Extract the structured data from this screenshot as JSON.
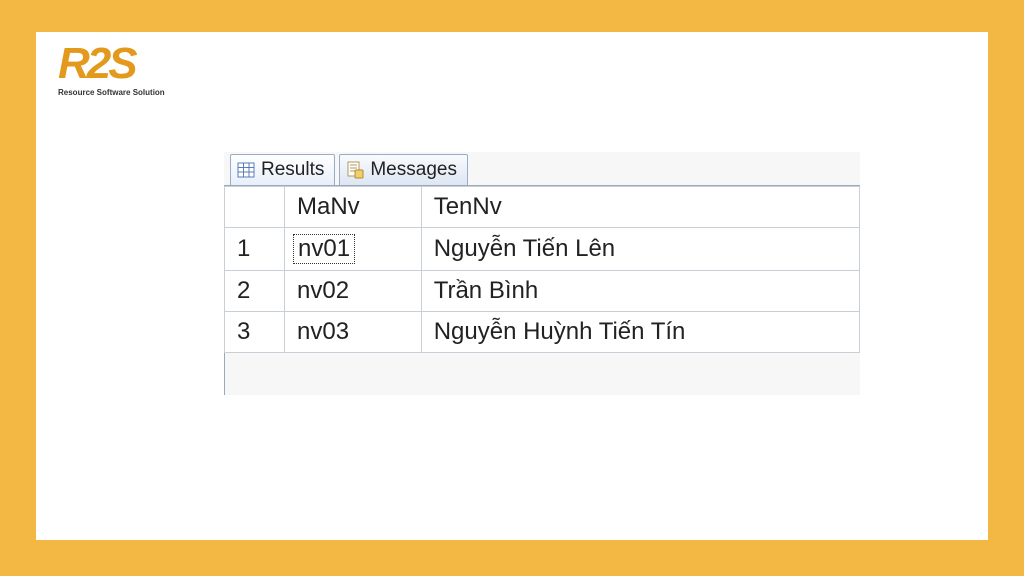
{
  "logo": {
    "text": "R2S",
    "tagline": "Resource Software Solution"
  },
  "tabs": {
    "results": "Results",
    "messages": "Messages"
  },
  "columns": {
    "col1": "MaNv",
    "col2": "TenNv"
  },
  "rows": [
    {
      "n": "1",
      "manv": "nv01",
      "tennv": "Nguyễn Tiến Lên"
    },
    {
      "n": "2",
      "manv": "nv02",
      "tennv": "Trần Bình"
    },
    {
      "n": "3",
      "manv": "nv03",
      "tennv": "Nguyễn Huỳnh Tiến Tín"
    }
  ]
}
